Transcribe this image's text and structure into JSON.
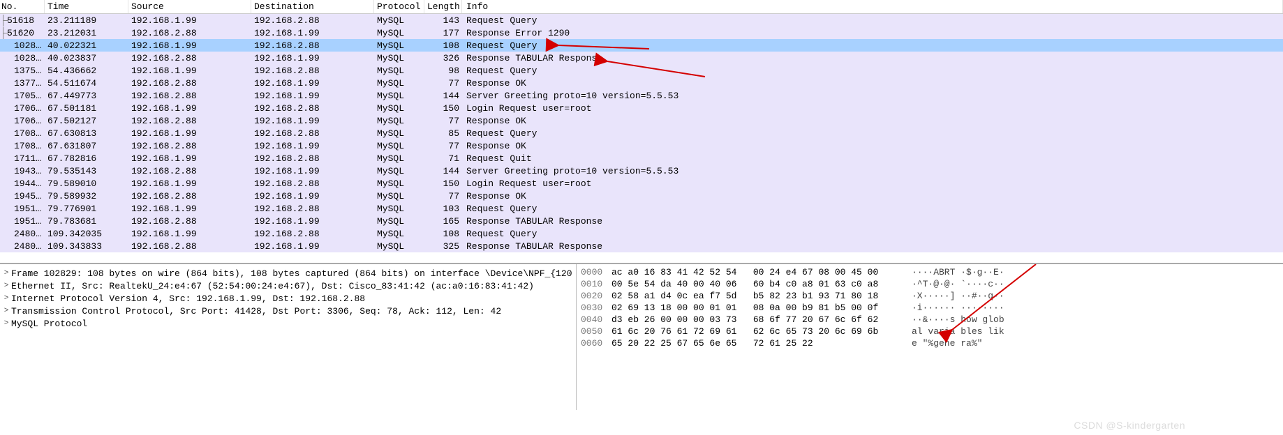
{
  "columns": {
    "no": "No.",
    "time": "Time",
    "source": "Source",
    "destination": "Destination",
    "protocol": "Protocol",
    "length": "Length",
    "info": "Info"
  },
  "packets": [
    {
      "no": "51618",
      "time": "23.211189",
      "src": "192.168.1.99",
      "dst": "192.168.2.88",
      "prot": "MySQL",
      "len": "143",
      "info": "Request Query",
      "tree": true
    },
    {
      "no": "51620",
      "time": "23.212031",
      "src": "192.168.2.88",
      "dst": "192.168.1.99",
      "prot": "MySQL",
      "len": "177",
      "info": "Response  Error 1290",
      "tree": true
    },
    {
      "no": "1028…",
      "time": "40.022321",
      "src": "192.168.1.99",
      "dst": "192.168.2.88",
      "prot": "MySQL",
      "len": "108",
      "info": "Request Query",
      "tree": false,
      "selected": true
    },
    {
      "no": "1028…",
      "time": "40.023837",
      "src": "192.168.2.88",
      "dst": "192.168.1.99",
      "prot": "MySQL",
      "len": "326",
      "info": "Response TABULAR Response",
      "tree": false
    },
    {
      "no": "1375…",
      "time": "54.436662",
      "src": "192.168.1.99",
      "dst": "192.168.2.88",
      "prot": "MySQL",
      "len": "98",
      "info": "Request Query",
      "tree": false
    },
    {
      "no": "1377…",
      "time": "54.511674",
      "src": "192.168.2.88",
      "dst": "192.168.1.99",
      "prot": "MySQL",
      "len": "77",
      "info": "Response  OK",
      "tree": false
    },
    {
      "no": "1705…",
      "time": "67.449773",
      "src": "192.168.2.88",
      "dst": "192.168.1.99",
      "prot": "MySQL",
      "len": "144",
      "info": "Server Greeting  proto=10 version=5.5.53",
      "tree": false
    },
    {
      "no": "1706…",
      "time": "67.501181",
      "src": "192.168.1.99",
      "dst": "192.168.2.88",
      "prot": "MySQL",
      "len": "150",
      "info": "Login Request user=root",
      "tree": false
    },
    {
      "no": "1706…",
      "time": "67.502127",
      "src": "192.168.2.88",
      "dst": "192.168.1.99",
      "prot": "MySQL",
      "len": "77",
      "info": "Response  OK",
      "tree": false
    },
    {
      "no": "1708…",
      "time": "67.630813",
      "src": "192.168.1.99",
      "dst": "192.168.2.88",
      "prot": "MySQL",
      "len": "85",
      "info": "Request Query",
      "tree": false
    },
    {
      "no": "1708…",
      "time": "67.631807",
      "src": "192.168.2.88",
      "dst": "192.168.1.99",
      "prot": "MySQL",
      "len": "77",
      "info": "Response  OK",
      "tree": false
    },
    {
      "no": "1711…",
      "time": "67.782816",
      "src": "192.168.1.99",
      "dst": "192.168.2.88",
      "prot": "MySQL",
      "len": "71",
      "info": "Request Quit",
      "tree": false
    },
    {
      "no": "1943…",
      "time": "79.535143",
      "src": "192.168.2.88",
      "dst": "192.168.1.99",
      "prot": "MySQL",
      "len": "144",
      "info": "Server Greeting  proto=10 version=5.5.53",
      "tree": false
    },
    {
      "no": "1944…",
      "time": "79.589010",
      "src": "192.168.1.99",
      "dst": "192.168.2.88",
      "prot": "MySQL",
      "len": "150",
      "info": "Login Request user=root",
      "tree": false
    },
    {
      "no": "1945…",
      "time": "79.589932",
      "src": "192.168.2.88",
      "dst": "192.168.1.99",
      "prot": "MySQL",
      "len": "77",
      "info": "Response  OK",
      "tree": false
    },
    {
      "no": "1951…",
      "time": "79.776901",
      "src": "192.168.1.99",
      "dst": "192.168.2.88",
      "prot": "MySQL",
      "len": "103",
      "info": "Request Query",
      "tree": false
    },
    {
      "no": "1951…",
      "time": "79.783681",
      "src": "192.168.2.88",
      "dst": "192.168.1.99",
      "prot": "MySQL",
      "len": "165",
      "info": "Response TABULAR Response",
      "tree": false
    },
    {
      "no": "2480…",
      "time": "109.342035",
      "src": "192.168.1.99",
      "dst": "192.168.2.88",
      "prot": "MySQL",
      "len": "108",
      "info": "Request Query",
      "tree": false
    },
    {
      "no": "2480…",
      "time": "109.343833",
      "src": "192.168.2.88",
      "dst": "192.168.1.99",
      "prot": "MySQL",
      "len": "325",
      "info": "Response TABULAR Response",
      "tree": false
    }
  ],
  "tree": [
    "Frame 102829: 108 bytes on wire (864 bits), 108 bytes captured (864 bits) on interface \\Device\\NPF_{120",
    "Ethernet II, Src: RealtekU_24:e4:67 (52:54:00:24:e4:67), Dst: Cisco_83:41:42 (ac:a0:16:83:41:42)",
    "Internet Protocol Version 4, Src: 192.168.1.99, Dst: 192.168.2.88",
    "Transmission Control Protocol, Src Port: 41428, Dst Port: 3306, Seq: 78, Ack: 112, Len: 42",
    "MySQL Protocol"
  ],
  "hex": [
    {
      "off": "0000",
      "b": "ac a0 16 83 41 42 52 54   00 24 e4 67 08 00 45 00",
      "a": "····ABRT ·$·g··E·"
    },
    {
      "off": "0010",
      "b": "00 5e 54 da 40 00 40 06   60 b4 c0 a8 01 63 c0 a8",
      "a": "·^T·@·@· `····c··"
    },
    {
      "off": "0020",
      "b": "02 58 a1 d4 0c ea f7 5d   b5 82 23 b1 93 71 80 18",
      "a": "·X·····] ··#··q··"
    },
    {
      "off": "0030",
      "b": "02 69 13 18 00 00 01 01   08 0a 00 b9 81 b5 00 0f",
      "a": "·i······ ········"
    },
    {
      "off": "0040",
      "b": "d3 eb 26 00 00 00 03 73   68 6f 77 20 67 6c 6f 62",
      "a": "··&····s how glob"
    },
    {
      "off": "0050",
      "b": "61 6c 20 76 61 72 69 61   62 6c 65 73 20 6c 69 6b",
      "a": "al varia bles lik"
    },
    {
      "off": "0060",
      "b": "65 20 22 25 67 65 6e 65   72 61 25 22",
      "a": "e \"%gene ra%\""
    }
  ],
  "watermark": "CSDN @S-kindergarten"
}
